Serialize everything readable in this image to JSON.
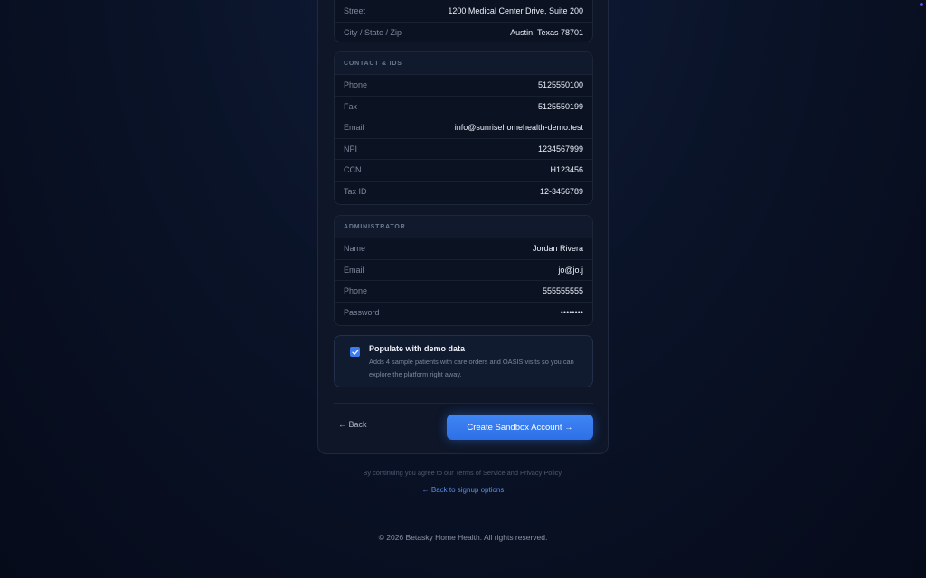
{
  "address": {
    "rows": [
      {
        "label": "Street",
        "value": "1200 Medical Center Drive, Suite 200"
      },
      {
        "label": "City / State / Zip",
        "value": "Austin, Texas 78701"
      }
    ]
  },
  "contact": {
    "header": "CONTACT & IDS",
    "rows": [
      {
        "label": "Phone",
        "value": "5125550100"
      },
      {
        "label": "Fax",
        "value": "5125550199"
      },
      {
        "label": "Email",
        "value": "info@sunrisehomehealth-demo.test"
      },
      {
        "label": "NPI",
        "value": "1234567999"
      },
      {
        "label": "CCN",
        "value": "H123456"
      },
      {
        "label": "Tax ID",
        "value": "12-3456789"
      }
    ]
  },
  "admin": {
    "header": "ADMINISTRATOR",
    "rows": [
      {
        "label": "Name",
        "value": "Jordan Rivera"
      },
      {
        "label": "Email",
        "value": "jo@jo.j"
      },
      {
        "label": "Phone",
        "value": "555555555"
      },
      {
        "label": "Password",
        "value": "••••••••"
      }
    ]
  },
  "demo": {
    "checked": true,
    "title": "Populate with demo data",
    "description": "Adds 4 sample patients with care orders and OASIS visits so you can explore the platform right away."
  },
  "actions": {
    "back_label": "← Back",
    "create_label": "Create Sandbox Account →"
  },
  "terms_text": "By continuing you agree to our Terms of Service and Privacy Policy.",
  "back_to_signup_label": "← Back to signup options",
  "footer_text": "© 2026 Betasky Home Health. All rights reserved.",
  "colors": {
    "accent": "#3d7bf0",
    "background": "#0a1328",
    "card": "#0e1628"
  }
}
